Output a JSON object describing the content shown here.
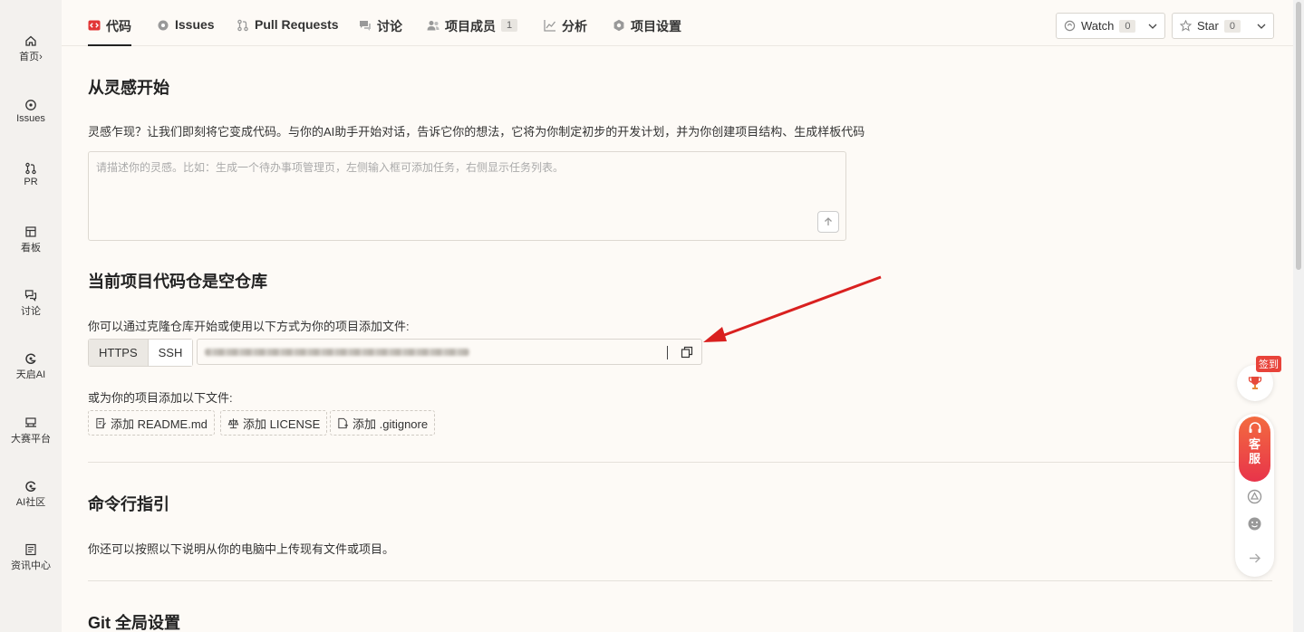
{
  "sidebar": {
    "items": [
      {
        "label": "首页",
        "icon": "home-icon"
      },
      {
        "label": "Issues",
        "icon": "issue-icon"
      },
      {
        "label": "PR",
        "icon": "pull-request-icon"
      },
      {
        "label": "看板",
        "icon": "board-icon"
      },
      {
        "label": "讨论",
        "icon": "discussion-icon"
      },
      {
        "label": "天启AI",
        "icon": "ai-icon"
      },
      {
        "label": "大赛平台",
        "icon": "contest-icon"
      },
      {
        "label": "AI社区",
        "icon": "community-icon"
      },
      {
        "label": "资讯中心",
        "icon": "news-icon"
      }
    ],
    "home_chevron": "›"
  },
  "tabs": [
    {
      "label": "代码",
      "icon": "code-icon"
    },
    {
      "label": "Issues",
      "icon": "issue-icon"
    },
    {
      "label": "Pull Requests",
      "icon": "pull-request-icon"
    },
    {
      "label": "讨论",
      "icon": "discussion-icon"
    },
    {
      "label": "项目成员",
      "icon": "members-icon",
      "count": "1"
    },
    {
      "label": "分析",
      "icon": "analytics-icon"
    },
    {
      "label": "项目设置",
      "icon": "settings-icon"
    }
  ],
  "watch": {
    "label": "Watch",
    "count": "0"
  },
  "star": {
    "label": "Star",
    "count": "0"
  },
  "inspire": {
    "title": "从灵感开始",
    "desc": "灵感乍现？让我们即刻将它变成代码。与你的AI助手开始对话，告诉它你的想法，它将为你制定初步的开发计划，并为你创建项目结构、生成样板代码",
    "placeholder": "请描述你的灵感。比如：生成一个待办事项管理页，左侧输入框可添加任务，右侧显示任务列表。"
  },
  "empty_repo": {
    "title": "当前项目代码仓是空仓库",
    "desc": "你可以通过克隆仓库开始或使用以下方式为你的项目添加文件:",
    "protocols": [
      "HTTPS",
      "SSH"
    ],
    "add_desc": "或为你的项目添加以下文件:",
    "add_buttons": [
      "添加 README.md",
      "添加 LICENSE",
      "添加 .gitignore"
    ]
  },
  "cli": {
    "title": "命令行指引",
    "desc": "你还可以按照以下说明从你的电脑中上传现有文件或项目。"
  },
  "git_config": {
    "title": "Git 全局设置"
  },
  "floating": {
    "signin": "签到",
    "service": "客服"
  },
  "colors": {
    "accent": "#e8344a",
    "background": "#fdfaf6",
    "annotation_arrow": "#d9201f"
  }
}
